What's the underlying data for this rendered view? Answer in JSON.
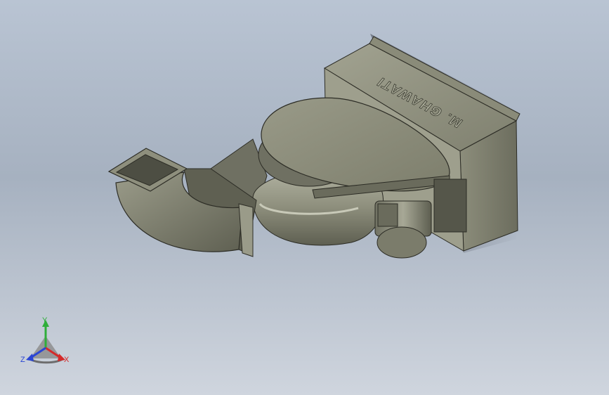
{
  "model": {
    "engraved_text": "M. GHAWATI"
  },
  "triad": {
    "x_label": "X",
    "y_label": "Y",
    "z_label": "Z",
    "x_color": "#d42a2a",
    "y_color": "#2fae3a",
    "z_color": "#2a45d4"
  },
  "colors": {
    "background_top": "#b9c4d3",
    "background_bottom": "#cfd5de",
    "part_base": "#8a8b79",
    "part_light": "#a9aa98",
    "part_dark": "#5f6052",
    "edge": "#2c2c25"
  }
}
